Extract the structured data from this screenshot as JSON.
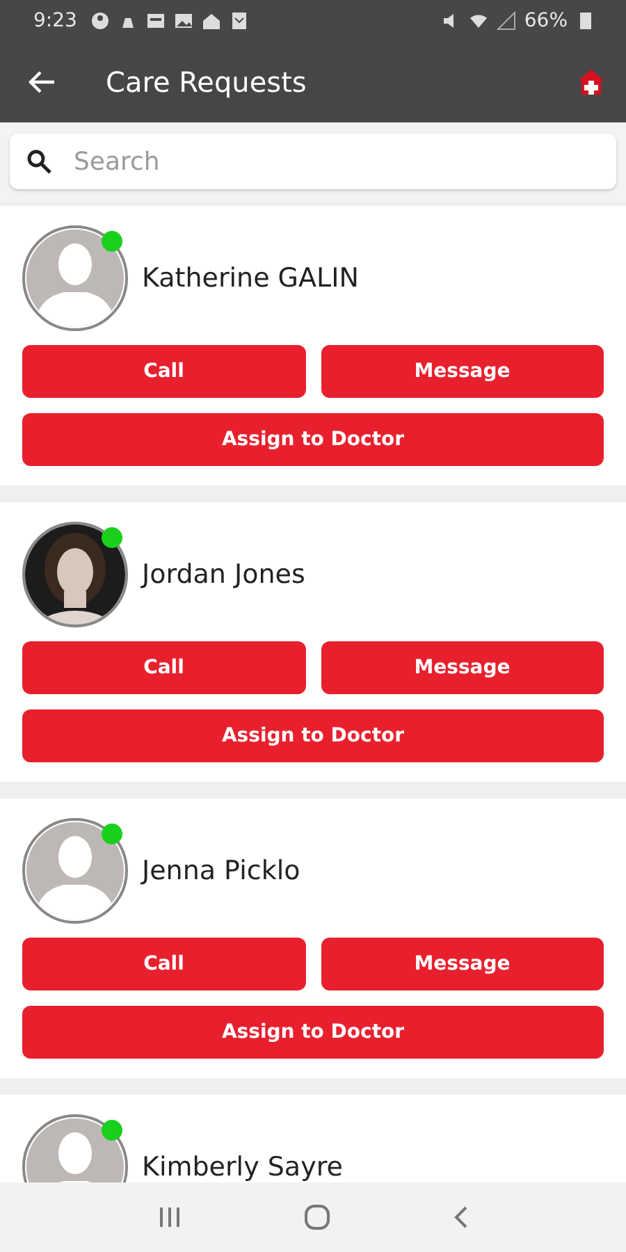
{
  "status_bar": {
    "time": "9:23",
    "battery": "66%"
  },
  "app_bar": {
    "title": "Care Requests"
  },
  "search": {
    "placeholder": "Search"
  },
  "requests": [
    {
      "name": "Katherine GALIN",
      "online": true,
      "kind": "placeholder",
      "buttons": [
        "Call",
        "Message",
        "Assign to Doctor"
      ]
    },
    {
      "name": "Jordan Jones",
      "online": true,
      "kind": "picture",
      "buttons": [
        "Call",
        "Message",
        "Assign to Doctor"
      ]
    },
    {
      "name": "Jenna Picklo",
      "online": true,
      "kind": "placeholder",
      "buttons": [
        "Call",
        "Message",
        "Assign to Doctor"
      ]
    },
    {
      "name": "Kimberly  Sayre",
      "online": true,
      "kind": "placeholder"
    }
  ]
}
